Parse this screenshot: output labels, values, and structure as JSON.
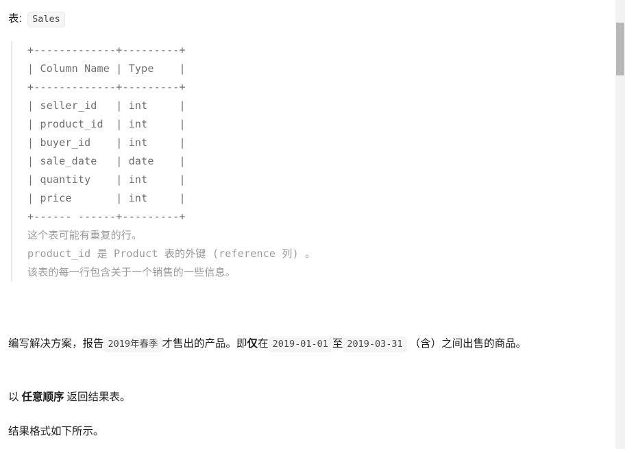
{
  "document": {
    "table_label_prefix": "表:",
    "table_name": "Sales",
    "schema_block": "+-------------+---------+\n| Column Name | Type    |\n+-------------+---------+\n| seller_id   | int     |\n| product_id  | int     |\n| buyer_id    | int     |\n| sale_date   | date    |\n| quantity    | int     |\n| price       | int     |\n+------ ------+---------+",
    "schema_columns": [
      {
        "name": "Column Name",
        "type": "Type"
      },
      {
        "name": "seller_id",
        "type": "int"
      },
      {
        "name": "product_id",
        "type": "int"
      },
      {
        "name": "buyer_id",
        "type": "int"
      },
      {
        "name": "sale_date",
        "type": "date"
      },
      {
        "name": "quantity",
        "type": "int"
      },
      {
        "name": "price",
        "type": "int"
      }
    ],
    "notes_block": "这个表可能有重复的行。\nproduct_id 是 Product 表的外键 (reference 列) 。\n该表的每一行包含关于一个销售的一些信息。",
    "notes_lines": [
      "这个表可能有重复的行。",
      "product_id 是 Product 表的外键 (reference 列) 。",
      "该表的每一行包含关于一个销售的一些信息。"
    ],
    "paragraph_main": {
      "part1": "编写解决方案，报告",
      "code_season": "2019年春季",
      "part2": "才售出的产品。即",
      "bold_only": "仅",
      "part3": "在",
      "code_date_start": "2019-01-01",
      "part4": "至",
      "code_date_end": "2019-03-31",
      "part5": "（含）之间出售的商品。"
    },
    "paragraph_order": {
      "part1": "以",
      "bold": "任意顺序",
      "part2": "返回结果表。"
    },
    "paragraph_format": "结果格式如下所示。"
  },
  "scrollbar": {
    "orientation": "vertical"
  },
  "colors": {
    "background": "#ffffff",
    "body_text": "#1c1c1c",
    "code_text": "#6e6e6e",
    "note_text": "#9a9a9a",
    "code_bg": "#f5f5f5",
    "quote_border": "#e8e8e8",
    "scrollbar_track": "#f2f2f2",
    "scrollbar_thumb": "#b8b8b8"
  }
}
